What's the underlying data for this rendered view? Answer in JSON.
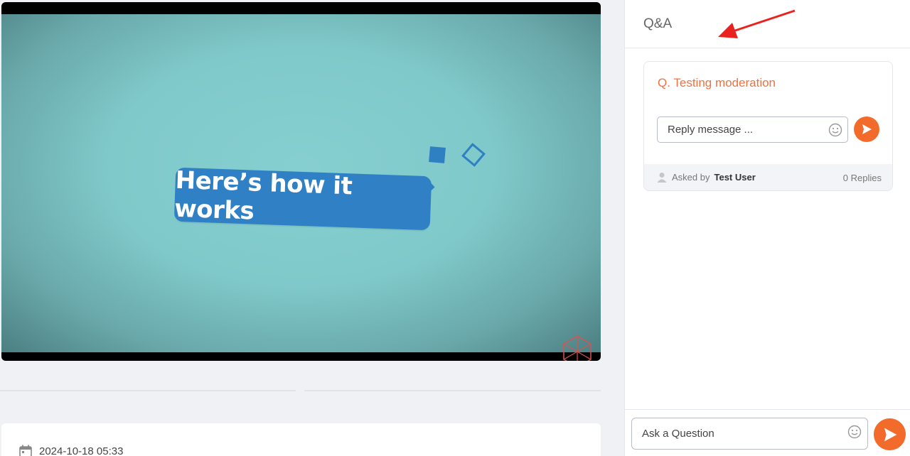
{
  "video": {
    "caption": "Here’s how it works"
  },
  "meta": {
    "date": "2024-10-18 05:33"
  },
  "qa": {
    "title": "Q&A",
    "question": {
      "text": "Q. Testing moderation",
      "reply_placeholder": "Reply message ...",
      "asked_by_label": "Asked by",
      "asked_by_user": "Test User",
      "replies": "0 Replies"
    },
    "ask_placeholder": "Ask a Question"
  },
  "colors": {
    "accent": "#f36b2a",
    "question_text": "#f4703e",
    "annotation_arrow": "#e8231f"
  }
}
